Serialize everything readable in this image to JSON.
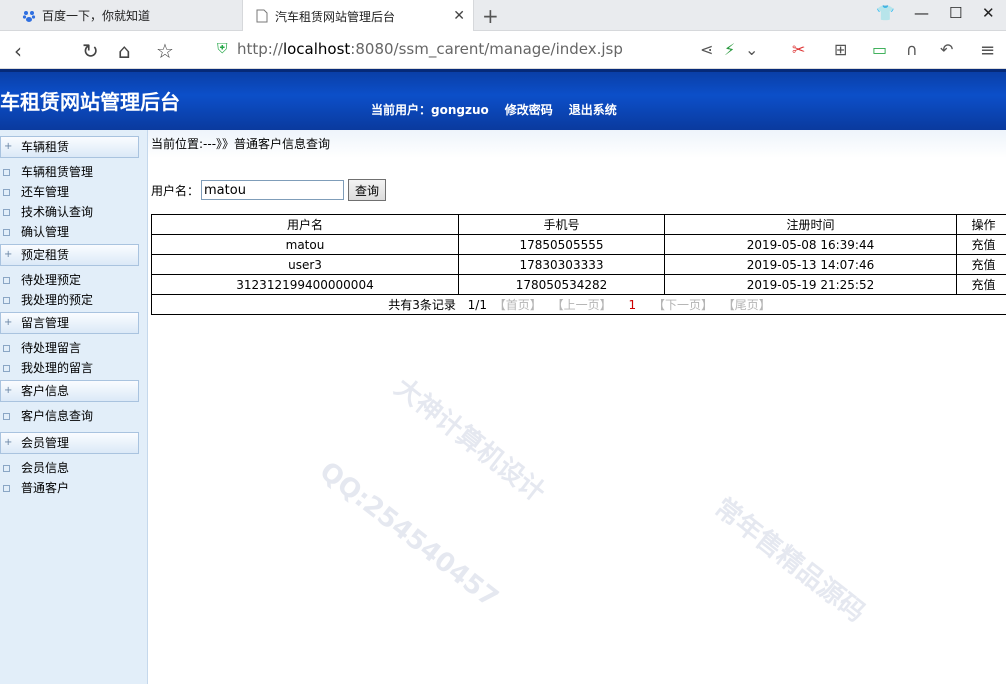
{
  "browser": {
    "tabs": [
      {
        "label": "百度一下，你就知道"
      },
      {
        "label": "汽车租赁网站管理后台"
      }
    ],
    "url_prefix": "http://",
    "url_host": "localhost",
    "url_rest": ":8080/ssm_carent/manage/index.jsp"
  },
  "header": {
    "title": "车租赁网站管理后台",
    "current_user_label": "当前用户：gongzuo",
    "change_password": "修改密码",
    "logout": "退出系统"
  },
  "sidebar": {
    "sections": [
      {
        "title": "车辆租赁",
        "items": [
          "车辆租赁管理",
          "还车管理",
          "技术确认查询",
          "确认管理"
        ]
      },
      {
        "title": "预定租赁",
        "items": [
          "待处理预定",
          "我处理的预定"
        ]
      },
      {
        "title": "留言管理",
        "items": [
          "待处理留言",
          "我处理的留言"
        ]
      },
      {
        "title": "客户信息",
        "items": [
          "客户信息查询"
        ]
      },
      {
        "title": "会员管理",
        "items": [
          "会员信息",
          "普通客户"
        ]
      }
    ]
  },
  "main": {
    "breadcrumb": "当前位置:---》》普通客户信息查询",
    "search": {
      "label": "用户名：",
      "value": "matou",
      "button": "查询"
    },
    "table": {
      "headers": [
        "用户名",
        "手机号",
        "注册时间",
        "操作"
      ],
      "rows": [
        {
          "username": "matou",
          "phone": "17850505555",
          "registered": "2019-05-08 16:39:44",
          "action": "充值"
        },
        {
          "username": "user3",
          "phone": "17830303333",
          "registered": "2019-05-13 14:07:46",
          "action": "充值"
        },
        {
          "username": "312312199400000004",
          "phone": "178050534282",
          "registered": "2019-05-19 21:25:52",
          "action": "充值"
        }
      ]
    },
    "pager": {
      "total": "共有3条记录",
      "page": "1/1",
      "first": "【首页】",
      "prev": "【上一页】",
      "current": "1",
      "next": "【下一页】",
      "last": "【尾页】"
    }
  },
  "watermarks": [
    "大神计算机设计",
    "QQ:254540457",
    "常年售精品源码"
  ]
}
